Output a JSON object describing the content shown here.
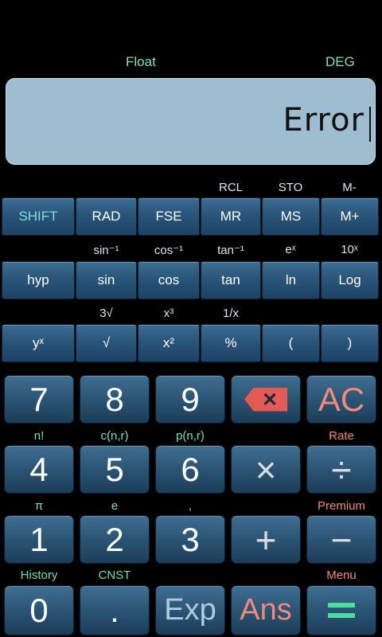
{
  "mode": {
    "float": "Float",
    "angle": "DEG"
  },
  "display": {
    "value": "Error"
  },
  "sci_rows": [
    {
      "labels": [
        "",
        "",
        "",
        "RCL",
        "STO",
        "M-"
      ],
      "keys": [
        "SHIFT",
        "RAD",
        "FSE",
        "MR",
        "MS",
        "M+"
      ]
    },
    {
      "labels": [
        "",
        "sin⁻¹",
        "cos⁻¹",
        "tan⁻¹",
        "eˣ",
        "10ˣ"
      ],
      "keys": [
        "hyp",
        "sin",
        "cos",
        "tan",
        "ln",
        "Log"
      ]
    },
    {
      "labels": [
        "",
        "3√",
        "x³",
        "1/x",
        "",
        ""
      ],
      "keys": [
        "yˣ",
        "√",
        "x²",
        "%",
        "(",
        ")"
      ]
    }
  ],
  "main_rows": [
    {
      "keys": [
        "7",
        "8",
        "9",
        "⌫",
        "AC"
      ],
      "labels": [
        "n!",
        "c(n,r)",
        "p(n,r)",
        "",
        "Rate"
      ]
    },
    {
      "keys": [
        "4",
        "5",
        "6",
        "×",
        "÷"
      ],
      "labels": [
        "π",
        "e",
        ",",
        "",
        "Premium"
      ]
    },
    {
      "keys": [
        "1",
        "2",
        "3",
        "+",
        "−"
      ],
      "labels": [
        "History",
        "CNST",
        "",
        "",
        "Menu"
      ]
    },
    {
      "keys": [
        "0",
        ".",
        "Exp",
        "Ans",
        "="
      ],
      "labels": []
    }
  ],
  "colors": {
    "accent_red": "#f08a7a",
    "accent_teal": "#4ae0c0",
    "display_bg": "#9fbdd0",
    "delete_red": "#e45a54"
  }
}
